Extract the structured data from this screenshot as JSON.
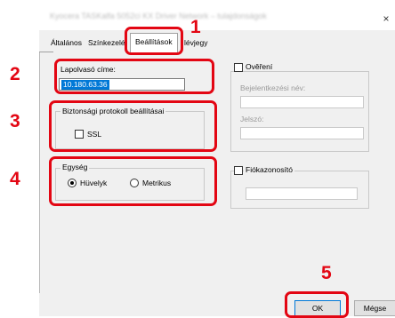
{
  "dialog": {
    "title": "Kyocera TASKalfa 5052ci KX Driver Network – tulajdonságok",
    "close_glyph": "×"
  },
  "tabs": [
    {
      "label": "Általános"
    },
    {
      "label": "Színkezelé"
    },
    {
      "label": "Beállítások"
    },
    {
      "label": "lévjegy"
    }
  ],
  "scanner_address": {
    "label": "Lapolvasó címe:",
    "value": "10.180.63.36"
  },
  "security": {
    "group_label": "Biztonsági protokoll beállításai",
    "ssl_label": "SSL",
    "ssl_checked": false
  },
  "unit": {
    "group_label": "Egység",
    "inch_label": "Hüvelyk",
    "metric_label": "Metrikus",
    "selected": "Hüvelyk"
  },
  "auth": {
    "checkbox_label": "Ověření",
    "checked": false,
    "login_label": "Bejelentkezési név:",
    "password_label": "Jelszó:"
  },
  "account": {
    "checkbox_label": "Fiókazonosító",
    "checked": false
  },
  "buttons": {
    "ok": "OK",
    "cancel": "Mégse"
  },
  "steps": [
    "1",
    "2",
    "3",
    "4",
    "5"
  ],
  "colors": {
    "highlight": "#e30613",
    "selection": "#0078d7"
  }
}
